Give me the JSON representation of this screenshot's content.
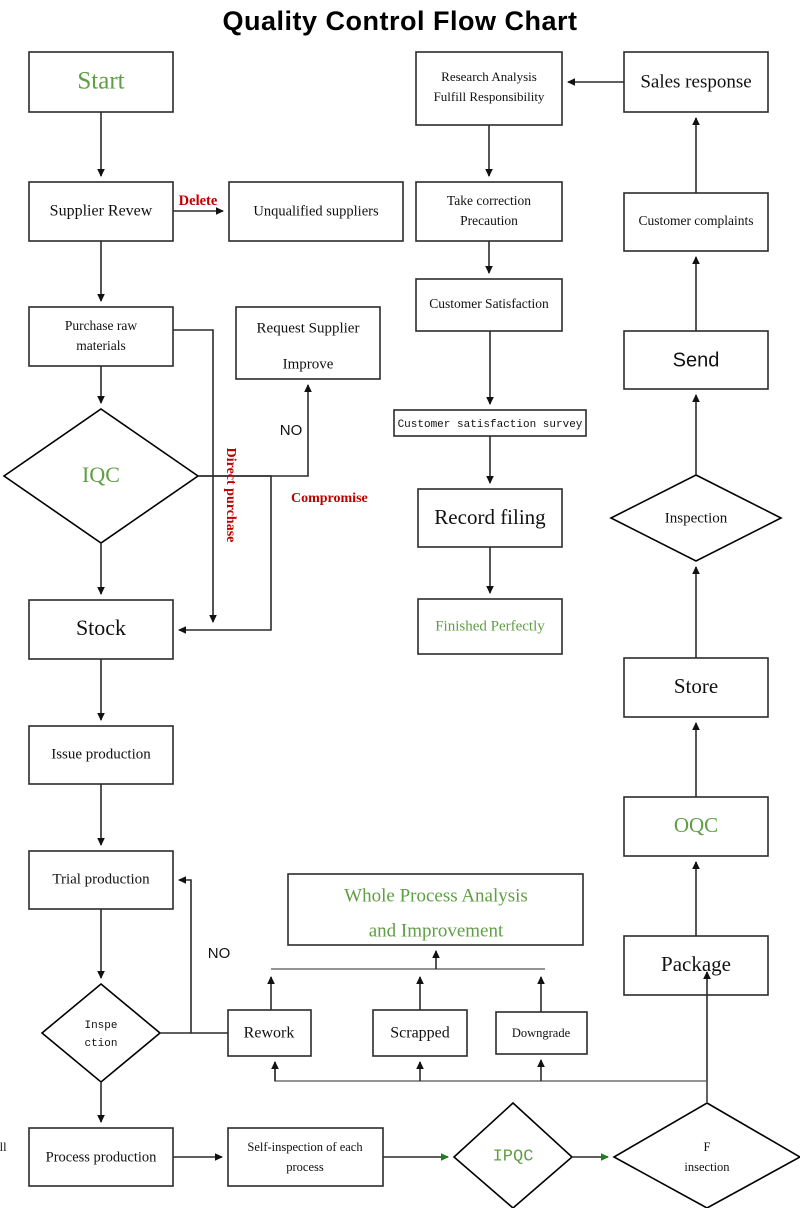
{
  "title": "Quality  Control  Flow  Chart",
  "palette": {
    "green": "#5f9e44",
    "red": "#c00000",
    "stroke": "#2b2b2b",
    "background": "#ffffff"
  },
  "nodes": {
    "start": {
      "label": "Start"
    },
    "supplier_review": {
      "label": "Supplier Revew"
    },
    "unqualified": {
      "label": "Unqualified suppliers"
    },
    "purchase_raw_1": {
      "label": "Purchase raw"
    },
    "purchase_raw_2": {
      "label": "materials"
    },
    "request_supplier_1": {
      "label": "Request Supplier"
    },
    "request_supplier_2": {
      "label": "Improve"
    },
    "iqc": {
      "label": "IQC"
    },
    "stock": {
      "label": "Stock"
    },
    "issue_production": {
      "label": "Issue production"
    },
    "trial_production": {
      "label": "Trial production"
    },
    "inspection_small_1": {
      "label": "Inspe"
    },
    "inspection_small_2": {
      "label": "ction"
    },
    "process_production": {
      "label": "Process production"
    },
    "self_inspection_1": {
      "label": "Self-inspection of each"
    },
    "self_inspection_2": {
      "label": "process"
    },
    "ipqc": {
      "label": "IPQC"
    },
    "full_insection_1": {
      "label": "Full"
    },
    "full_insection_2": {
      "label": "insection"
    },
    "rework": {
      "label": "Rework"
    },
    "scrapped": {
      "label": "Scrapped"
    },
    "downgrade": {
      "label": "Downgrade"
    },
    "whole_process_1": {
      "label": "Whole Process Analysis"
    },
    "whole_process_2": {
      "label": "and Improvement"
    },
    "package": {
      "label": "Package"
    },
    "oqc": {
      "label": "OQC"
    },
    "store": {
      "label": "Store"
    },
    "inspection_diamond": {
      "label": "Inspection"
    },
    "send": {
      "label": "Send"
    },
    "customer_complaints": {
      "label": "Customer complaints"
    },
    "sales_response": {
      "label": "Sales response"
    },
    "research_analysis_1": {
      "label": "Research Analysis"
    },
    "research_analysis_2": {
      "label": "Fulfill Responsibility"
    },
    "take_correction_1": {
      "label": "Take correction"
    },
    "take_correction_2": {
      "label": "Precaution"
    },
    "customer_satisfaction": {
      "label": "Customer Satisfaction"
    },
    "satisfaction_survey": {
      "label": "Customer satisfaction survey"
    },
    "record_filing": {
      "label": "Record filing"
    },
    "finished": {
      "label": "Finished Perfectly"
    }
  },
  "edge_labels": {
    "delete": {
      "label": "Delete"
    },
    "no_iqc": {
      "label": "NO"
    },
    "direct_purchase": {
      "label": "Direct purchase"
    },
    "compromise": {
      "label": "Compromise"
    },
    "no_inspection": {
      "label": "NO"
    }
  },
  "chart_data": {
    "type": "diagram",
    "title": "Quality Control Flow Chart",
    "flow": [
      "Start -> Supplier Revew",
      "Supplier Revew -[Delete]-> Unqualified suppliers",
      "Supplier Revew -> Purchase raw materials",
      "Purchase raw materials -> IQC",
      "Purchase raw materials -[Direct purchase]-> Stock",
      "IQC -[NO]-> Request Supplier Improve",
      "IQC -[Compromise]-> Stock",
      "IQC -> Stock",
      "Stock -> Issue production",
      "Issue production -> Trial production",
      "Trial production -> Inspection",
      "Inspection -[NO]-> Trial production",
      "Inspection -> Process production",
      "Process production -> Self-inspection of each process",
      "Self-inspection of each process -> IPQC",
      "IPQC -> Full insection",
      "Full insection -> Package",
      "Full insection -> Rework / Scrapped / Downgrade",
      "Rework / Scrapped / Downgrade -> Whole Process Analysis and Improvement",
      "Rework -> Trial production",
      "Package -> OQC",
      "OQC -> Store",
      "Store -> Inspection",
      "Inspection -> Send",
      "Send -> Customer complaints",
      "Customer complaints -> Sales response",
      "Sales response -> Research Analysis Fulfill Responsibility",
      "Research Analysis Fulfill Responsibility -> Take correction Precaution",
      "Take correction Precaution -> Customer Satisfaction",
      "Customer Satisfaction -> Customer satisfaction survey",
      "Customer satisfaction survey -> Record filing",
      "Record filing -> Finished Perfectly"
    ]
  }
}
